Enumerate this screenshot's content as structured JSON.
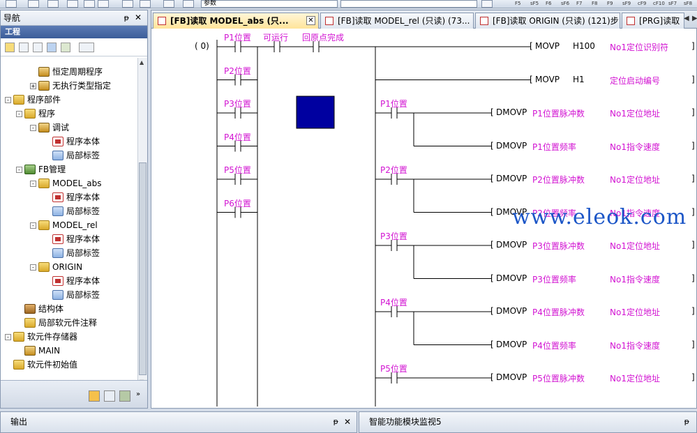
{
  "toolbar": {
    "combo_value": "参数",
    "fkeys": [
      "F5",
      "sF5",
      "F6",
      "sF6",
      "F7",
      "F8",
      "F9",
      "sF9",
      "cF9",
      "cF10",
      "sF7",
      "sF8"
    ]
  },
  "nav": {
    "title": "导航",
    "pin": "ᵽ",
    "close": "✕",
    "subtitle": "工程",
    "tree": [
      {
        "label": "恒定周期程序",
        "depth": 2,
        "icon": "dev"
      },
      {
        "label": "无执行类型指定",
        "depth": 2,
        "icon": "dev",
        "expander": "+"
      },
      {
        "label": "程序部件",
        "depth": 0,
        "icon": "folder",
        "expander": "-"
      },
      {
        "label": "程序",
        "depth": 1,
        "icon": "folder",
        "expander": "-"
      },
      {
        "label": "调试",
        "depth": 2,
        "icon": "dev",
        "expander": "-"
      },
      {
        "label": "程序本体",
        "depth": 3,
        "icon": "prog"
      },
      {
        "label": "局部标签",
        "depth": 3,
        "icon": "label"
      },
      {
        "label": "FB管理",
        "depth": 1,
        "icon": "block",
        "expander": "-"
      },
      {
        "label": "MODEL_abs",
        "depth": 2,
        "icon": "folder",
        "expander": "-"
      },
      {
        "label": "程序本体",
        "depth": 3,
        "icon": "prog",
        "selected": true
      },
      {
        "label": "局部标签",
        "depth": 3,
        "icon": "label"
      },
      {
        "label": "MODEL_rel",
        "depth": 2,
        "icon": "folder",
        "expander": "-"
      },
      {
        "label": "程序本体",
        "depth": 3,
        "icon": "prog"
      },
      {
        "label": "局部标签",
        "depth": 3,
        "icon": "label"
      },
      {
        "label": "ORIGIN",
        "depth": 2,
        "icon": "folder",
        "expander": "-"
      },
      {
        "label": "程序本体",
        "depth": 3,
        "icon": "prog"
      },
      {
        "label": "局部标签",
        "depth": 3,
        "icon": "label"
      },
      {
        "label": "结构体",
        "depth": 1,
        "icon": "struct"
      },
      {
        "label": "局部软元件注释",
        "depth": 1,
        "icon": "folder"
      },
      {
        "label": "软元件存储器",
        "depth": 0,
        "icon": "folder",
        "expander": "-"
      },
      {
        "label": "MAIN",
        "depth": 1,
        "icon": "dev"
      },
      {
        "label": "软元件初始值",
        "depth": 0,
        "icon": "folder"
      }
    ]
  },
  "tabs": [
    {
      "label": "[FB]读取 MODEL_abs (只...",
      "active": true
    },
    {
      "label": "[FB]读取 MODEL_rel (只读) (73..."
    },
    {
      "label": "[FB]读取 ORIGIN (只读) (121)步"
    },
    {
      "label": "[PRG]读取"
    }
  ],
  "ladder": {
    "step": "(   0)",
    "contacts_top": [
      "P1位置",
      "可运行",
      "回原点完成"
    ],
    "left_contacts": [
      "P2位置",
      "P3位置",
      "P4位置",
      "P5位置",
      "P6位置"
    ],
    "right_contacts": [
      "P1位置",
      "P2位置",
      "P3位置",
      "P4位置",
      "P5位置"
    ],
    "coils": [
      {
        "inst": "MOVP",
        "op1": "H100",
        "op1_color": "black",
        "op2": "No1定位识别符"
      },
      {
        "inst": "MOVP",
        "op1": "H1",
        "op1_color": "black",
        "op2": "定位启动编号"
      },
      {
        "inst": "DMOVP",
        "op1": "P1位置脉冲数",
        "op1_color": "magenta",
        "op2": "No1定位地址"
      },
      {
        "inst": "DMOVP",
        "op1": "P1位置频率",
        "op1_color": "magenta",
        "op2": "No1指令速度"
      },
      {
        "inst": "DMOVP",
        "op1": "P2位置脉冲数",
        "op1_color": "magenta",
        "op2": "No1定位地址"
      },
      {
        "inst": "DMOVP",
        "op1": "P2位置频率",
        "op1_color": "magenta",
        "op2": "No1指令速度"
      },
      {
        "inst": "DMOVP",
        "op1": "P3位置脉冲数",
        "op1_color": "magenta",
        "op2": "No1定位地址"
      },
      {
        "inst": "DMOVP",
        "op1": "P3位置频率",
        "op1_color": "magenta",
        "op2": "No1指令速度"
      },
      {
        "inst": "DMOVP",
        "op1": "P4位置脉冲数",
        "op1_color": "magenta",
        "op2": "No1定位地址"
      },
      {
        "inst": "DMOVP",
        "op1": "P4位置频率",
        "op1_color": "magenta",
        "op2": "No1指令速度"
      },
      {
        "inst": "DMOVP",
        "op1": "P5位置脉冲数",
        "op1_color": "magenta",
        "op2": "No1定位地址"
      }
    ],
    "cursor_color": "#0000a0"
  },
  "watermark": "www.eleok.com",
  "output_panel": {
    "title": "输出",
    "pin": "ᵽ",
    "close": "✕"
  },
  "monitor_panel": {
    "title": "智能功能模块监视5",
    "pin": "ᵽ"
  }
}
